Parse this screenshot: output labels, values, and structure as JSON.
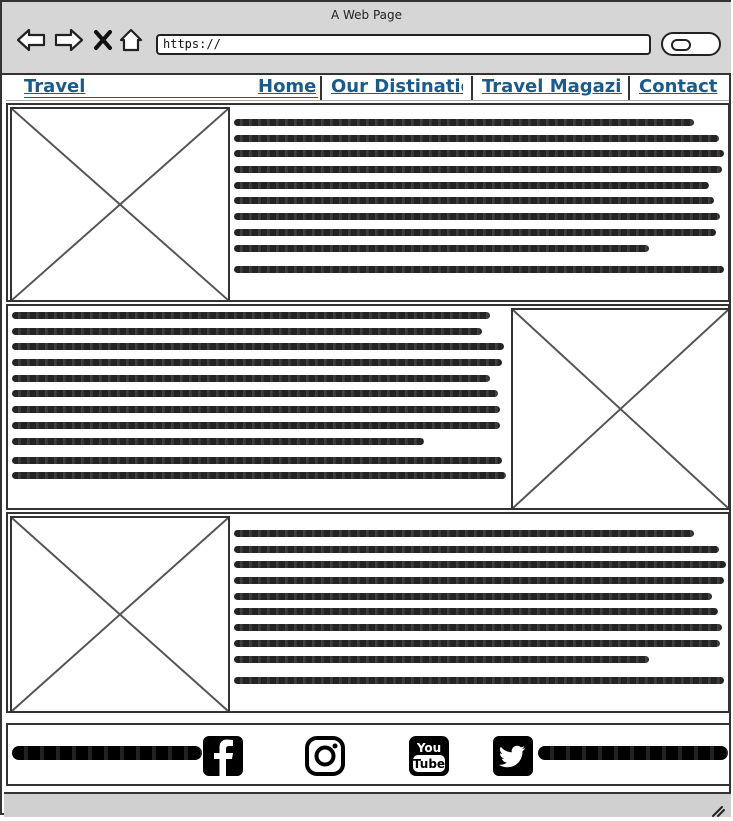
{
  "window": {
    "title": "A Web Page"
  },
  "toolbar": {
    "url": "https://"
  },
  "nav": {
    "logo": "Travel",
    "links": [
      "Home",
      "Our Distinatio",
      "Travel Magazin",
      "Contact"
    ]
  },
  "sections": [
    {
      "image_side": "left"
    },
    {
      "image_side": "right"
    },
    {
      "image_side": "left"
    }
  ],
  "footer": {
    "social_icons": [
      "facebook-icon",
      "instagram-icon",
      "youtube-icon",
      "twitter-icon"
    ],
    "youtube_text_top": "You",
    "youtube_text_bottom": "Tube"
  },
  "colors": {
    "link": "#1a5b8a",
    "chrome": "#d6d6d6",
    "ink": "#333333"
  }
}
